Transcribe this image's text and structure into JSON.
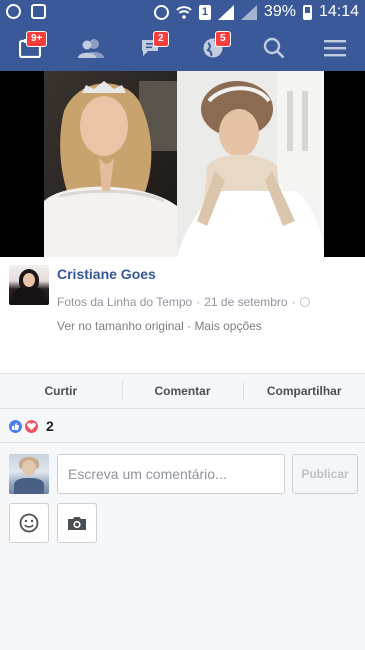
{
  "status_bar": {
    "battery_percent": "39%",
    "time": "14:14",
    "icons": [
      "whatsapp-icon",
      "gallery-icon",
      "alarm-icon",
      "wifi-icon",
      "sim-1-icon",
      "signal-icon",
      "battery-icon"
    ],
    "sim_label": "1"
  },
  "nav": {
    "friend_requests_badge": "9+",
    "messages_badge": "2",
    "notifications_badge": "5",
    "icons": [
      "feed-icon",
      "friends-icon",
      "messages-icon",
      "notifications-globe-icon",
      "search-icon",
      "menu-icon"
    ]
  },
  "post": {
    "author": "Cristiane Goes",
    "album": "Fotos da Linha do Tempo",
    "separator": "·",
    "date": "21 de setembro",
    "view_full_size": "Ver no tamanho original",
    "more_options": "Mais opções"
  },
  "actions": {
    "like": "Curtir",
    "comment": "Comentar",
    "share": "Compartilhar"
  },
  "reactions": {
    "count": "2",
    "types": [
      "like",
      "love"
    ]
  },
  "composer": {
    "placeholder": "Escreva um comentário...",
    "value": "",
    "publish": "Publicar"
  },
  "colors": {
    "brand": "#3b5998",
    "link": "#365899",
    "badge": "#fa3e3e",
    "like": "#4a7df0",
    "love": "#f25268"
  }
}
